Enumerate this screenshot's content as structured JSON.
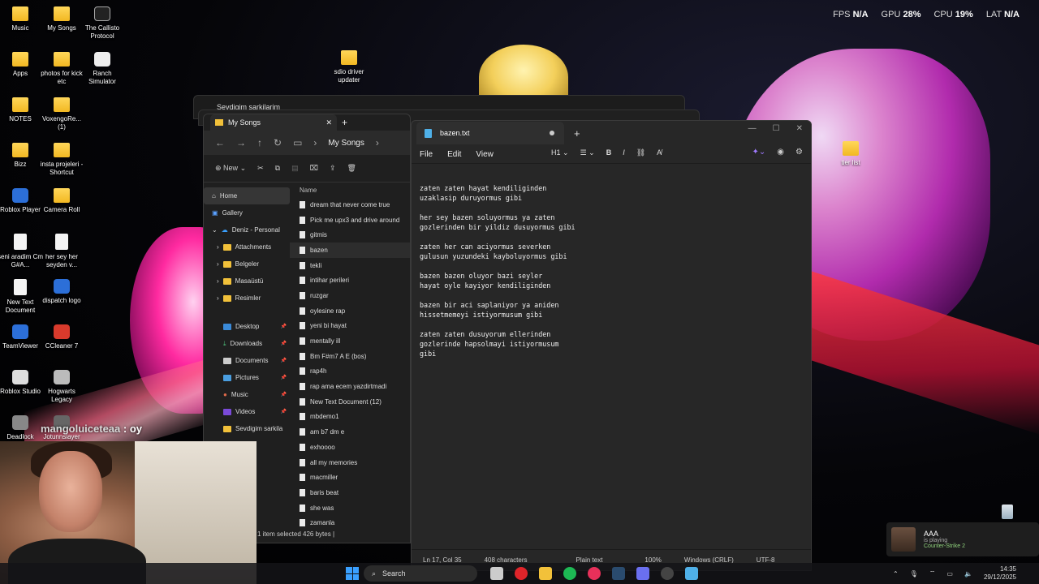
{
  "hud": {
    "fps_label": "FPS",
    "fps": "N/A",
    "gpu_label": "GPU",
    "gpu": "28%",
    "cpu_label": "CPU",
    "cpu": "19%",
    "lat_label": "LAT",
    "lat": "N/A"
  },
  "desktop_icons": [
    {
      "label": "Music"
    },
    {
      "label": "My Songs"
    },
    {
      "label": "The Callisto Protocol"
    },
    {
      "label": "Apps"
    },
    {
      "label": "photos for kick etc"
    },
    {
      "label": "Ranch Simulator"
    },
    {
      "label": "NOTES"
    },
    {
      "label": "VoxengoRe... (1)"
    },
    {
      "label": "Bizz"
    },
    {
      "label": "insta projeleri - Shortcut"
    },
    {
      "label": "Roblox Player"
    },
    {
      "label": "Camera Roll"
    },
    {
      "label": "seni aradim Cm G#A..."
    },
    {
      "label": "her sey her seyden v..."
    },
    {
      "label": "New Text Document"
    },
    {
      "label": "dispatch logo"
    },
    {
      "label": "TeamViewer"
    },
    {
      "label": "CCleaner 7"
    },
    {
      "label": "Roblox Studio"
    },
    {
      "label": "Hogwarts Legacy"
    },
    {
      "label": "Deadlock"
    },
    {
      "label": "Jotunnslayer"
    },
    {
      "label": "sdio driver updater"
    },
    {
      "label": "tier list"
    }
  ],
  "back_window": {
    "tab_title": "Sevdigim sarkilarim"
  },
  "explorer": {
    "tab_title": "My Songs",
    "breadcrumb": "My Songs",
    "new_label": "New",
    "sidebar": [
      {
        "label": "Home"
      },
      {
        "label": "Gallery"
      },
      {
        "label": "Deniz - Personal"
      },
      {
        "label": "Attachments"
      },
      {
        "label": "Belgeler"
      },
      {
        "label": "Masaüstü"
      },
      {
        "label": "Resimler"
      },
      {
        "label": "Desktop"
      },
      {
        "label": "Downloads"
      },
      {
        "label": "Documents"
      },
      {
        "label": "Pictures"
      },
      {
        "label": "Music"
      },
      {
        "label": "Videos"
      },
      {
        "label": "Sevdigim sarkila"
      }
    ],
    "column_name": "Name",
    "files": [
      "dream that never come true",
      "Pick me upx3 and drive around",
      "gitmis",
      "bazen",
      "tekli",
      "intihar perileri",
      "ruzgar",
      "oylesine rap",
      "yeni bi hayat",
      "mentally ill",
      "Bm F#m7 A E (bos)",
      "rap4h",
      "rap ama ecem yazdirtmadi",
      "New Text Document (12)",
      "mbdemo1",
      "am b7 dm e",
      "exhoooo",
      "all my memories",
      "macmiller",
      "baris beat",
      "she was",
      "zamanla"
    ],
    "status": "1 item selected  426 bytes  |"
  },
  "notepad": {
    "tab_title": "bazen.txt",
    "menu": {
      "file": "File",
      "edit": "Edit",
      "view": "View",
      "heading": "H1"
    },
    "content": "zaten zaten hayat kendiliginden\nuzaklasip duruyormus gibi\n\nher sey bazen soluyormus ya zaten\ngozlerinden bir yildiz dusuyormus gibi\n\nzaten her can aciyormus severken\ngulusun yuzundeki kayboluyormus gibi\n\nbazen bazen oluyor bazi seyler\nhayat oyle kayiyor kendiliginden\n\nbazen bir aci saplaniyor ya aniden\nhissetmemeyi istiyormusum gibi\n\nzaten zaten dusuyorum ellerinden\ngozlerinde hapsolmayi istiyormusum\ngibi",
    "status": {
      "position": "Ln 17, Col 35",
      "chars": "408 characters",
      "format": "Plain text",
      "zoom": "100%",
      "eol": "Windows (CRLF)",
      "encoding": "UTF-8"
    }
  },
  "chat": {
    "user": "mangoluiceteaa",
    "message": ": oy"
  },
  "notification": {
    "user": "AAA",
    "status": "is playing",
    "game": "Counter-Strike 2"
  },
  "taskbar": {
    "search_placeholder": "Search",
    "time": "14:35",
    "date": "29/12/2025"
  },
  "colors": {
    "accent": "#3aa0ff",
    "folder": "#f2c13a"
  }
}
